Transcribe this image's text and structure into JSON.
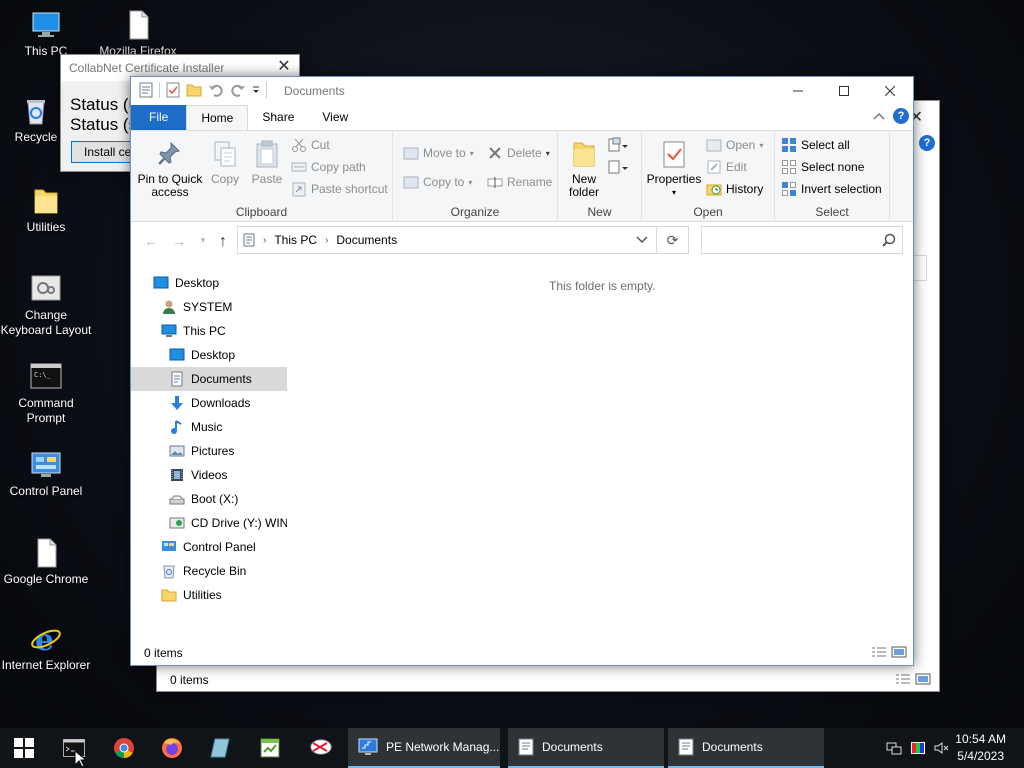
{
  "desktop": {
    "icons": [
      {
        "label": "This PC",
        "icon": "computer-icon"
      },
      {
        "label": "Mozilla Firefox",
        "icon": "document-icon"
      },
      {
        "label": "Recycle",
        "icon": "recycle-bin-icon"
      },
      {
        "label": "Utilities",
        "icon": "folder-icon"
      },
      {
        "label": "Change Keyboard Layout",
        "icon": "keyboard-settings-icon"
      },
      {
        "label": "Command Prompt",
        "icon": "command-prompt-icon"
      },
      {
        "label": "Control Panel",
        "icon": "control-panel-icon"
      },
      {
        "label": "Google Chrome",
        "icon": "document-icon"
      },
      {
        "label": "Internet Explorer",
        "icon": "internet-explorer-icon"
      }
    ]
  },
  "collab_dialog": {
    "title": "CollabNet Certificate Installer",
    "status_line_1": "Status (u",
    "status_line_2": "Status (s",
    "install_label": "Install cert"
  },
  "background_window": {
    "status": "0 items"
  },
  "explorer": {
    "title": "Documents",
    "tabs": {
      "file": "File",
      "home": "Home",
      "share": "Share",
      "view": "View"
    },
    "ribbon": {
      "clipboard": {
        "label": "Clipboard",
        "pin": "Pin to Quick access",
        "copy": "Copy",
        "paste": "Paste",
        "cut": "Cut",
        "copy_path": "Copy path",
        "paste_shortcut": "Paste shortcut"
      },
      "organize": {
        "label": "Organize",
        "move_to": "Move to",
        "copy_to": "Copy to",
        "delete": "Delete",
        "rename": "Rename"
      },
      "new": {
        "label": "New",
        "new_folder": "New folder"
      },
      "open": {
        "label": "Open",
        "properties": "Properties",
        "open": "Open",
        "edit": "Edit",
        "history": "History"
      },
      "select": {
        "label": "Select",
        "select_all": "Select all",
        "select_none": "Select none",
        "invert": "Invert selection"
      }
    },
    "address": {
      "this_pc": "This PC",
      "documents": "Documents"
    },
    "search": {
      "placeholder": ""
    },
    "nav": [
      {
        "label": "Desktop",
        "icon": "desktop-icon"
      },
      {
        "label": "SYSTEM",
        "icon": "user-icon"
      },
      {
        "label": "This PC",
        "icon": "computer-icon"
      },
      {
        "label": "Desktop",
        "icon": "desktop-icon"
      },
      {
        "label": "Documents",
        "icon": "documents-icon"
      },
      {
        "label": "Downloads",
        "icon": "downloads-icon"
      },
      {
        "label": "Music",
        "icon": "music-icon"
      },
      {
        "label": "Pictures",
        "icon": "pictures-icon"
      },
      {
        "label": "Videos",
        "icon": "videos-icon"
      },
      {
        "label": "Boot (X:)",
        "icon": "drive-icon"
      },
      {
        "label": "CD Drive (Y:) WIN",
        "icon": "cd-drive-icon"
      },
      {
        "label": "Control Panel",
        "icon": "control-panel-icon"
      },
      {
        "label": "Recycle Bin",
        "icon": "recycle-bin-icon"
      },
      {
        "label": "Utilities",
        "icon": "folder-icon"
      }
    ],
    "empty_message": "This folder is empty.",
    "status": "0 items"
  },
  "taskbar": {
    "tasks": [
      {
        "label": "PE Network Manag...",
        "icon": "network-manager-icon"
      },
      {
        "label": "Documents",
        "icon": "explorer-icon"
      },
      {
        "label": "Documents",
        "icon": "explorer-icon"
      }
    ],
    "clock": {
      "time": "10:54 AM",
      "date": "5/4/2023"
    }
  },
  "colors": {
    "accent": "#1e6ec8",
    "taskbar": "#101418",
    "active_task_underline": "#76b9ed"
  }
}
